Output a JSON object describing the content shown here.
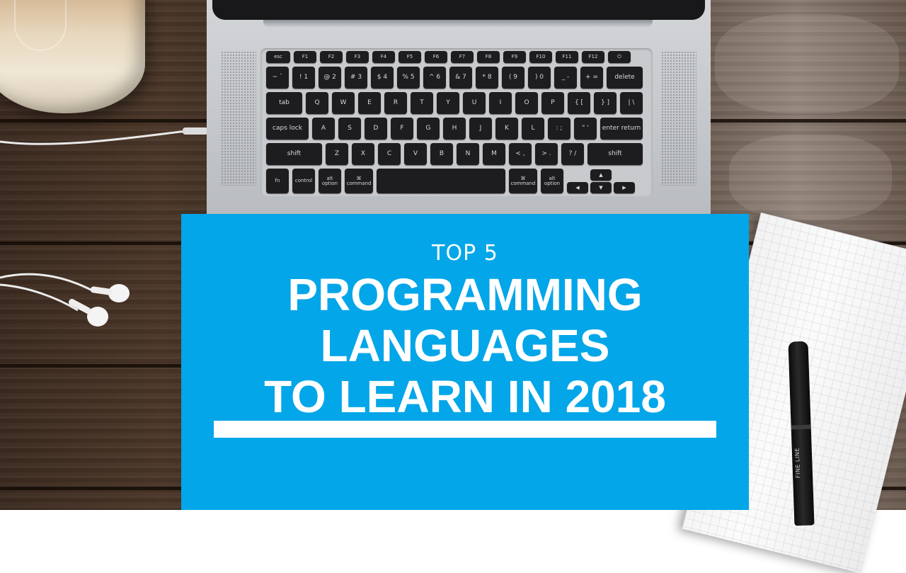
{
  "banner": {
    "subtitle": "TOP 5",
    "title_line1": "PROGRAMMING",
    "title_line2": "LANGUAGES",
    "title_line3": "TO LEARN IN 2018",
    "panel_color": "#03a6e8",
    "text_color": "#ffffff"
  },
  "keyboard": {
    "row0": [
      "esc",
      "F1",
      "F2",
      "F3",
      "F4",
      "F5",
      "F6",
      "F7",
      "F8",
      "F9",
      "F10",
      "F11",
      "F12",
      "⏻"
    ],
    "row1": [
      "~ `",
      "! 1",
      "@ 2",
      "# 3",
      "$ 4",
      "% 5",
      "^ 6",
      "& 7",
      "* 8",
      "( 9",
      ") 0",
      "_ -",
      "+ =",
      "delete"
    ],
    "row2": [
      "tab",
      "Q",
      "W",
      "E",
      "R",
      "T",
      "Y",
      "U",
      "I",
      "O",
      "P",
      "{ [",
      "} ]",
      "| \\"
    ],
    "row3": [
      "caps lock",
      "A",
      "S",
      "D",
      "F",
      "G",
      "H",
      "J",
      "K",
      "L",
      ": ;",
      "\" '",
      "enter return"
    ],
    "row4": [
      "shift",
      "Z",
      "X",
      "C",
      "V",
      "B",
      "N",
      "M",
      "< ,",
      "> .",
      "? /",
      "shift"
    ],
    "row5": [
      "fn",
      "control",
      "alt option",
      "⌘ command",
      "",
      "⌘ command",
      "alt option"
    ],
    "arrows": [
      "◀",
      "▲",
      "▼",
      "▶"
    ]
  },
  "pen": {
    "label": "FINE LINE"
  }
}
